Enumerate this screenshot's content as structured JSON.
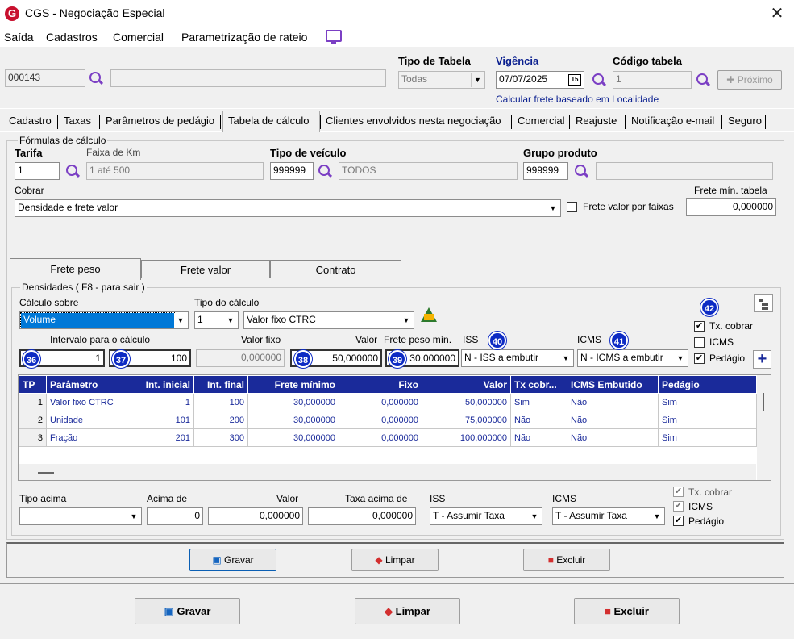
{
  "window": {
    "title": "CGS - Negociação Especial",
    "logo": "G"
  },
  "menu": [
    "Saída",
    "Cadastros",
    "Comercial",
    "Parametrização de rateio"
  ],
  "header": {
    "code": "000143",
    "tipo_tabela_label": "Tipo de Tabela",
    "tipo_tabela_value": "Todas",
    "vigencia_label": "Vigência",
    "vigencia_value": "07/07/2025",
    "calendar_day": "15",
    "codigo_tabela_label": "Código tabela",
    "codigo_tabela_value": "1",
    "proximo_label": "Próximo",
    "calc_link": "Calcular frete baseado em Localidade"
  },
  "tabs": [
    "Cadastro",
    "Taxas",
    "Parâmetros de pedágio",
    "Tabela de cálculo",
    "Clientes envolvidos nesta negociação",
    "Comercial",
    "Reajuste",
    "Notificação e-mail",
    "Seguro"
  ],
  "formulas": {
    "legend": "Fórmulas de cálculo",
    "tarifa_label": "Tarifa",
    "tarifa_value": "1",
    "faixa_label": "Faixa de Km",
    "faixa_value": "1 até 500",
    "tipo_veiculo_label": "Tipo de veículo",
    "tipo_veiculo_code": "999999",
    "tipo_veiculo_desc": "TODOS",
    "grupo_label": "Grupo produto",
    "grupo_code": "999999",
    "grupo_desc": "",
    "cobrar_label": "Cobrar",
    "cobrar_value": "Densidade e frete valor",
    "frete_faixas_label": "Frete valor por faixas",
    "frete_min_label": "Frete mín. tabela",
    "frete_min_value": "0,000000"
  },
  "inner_tabs": [
    "Frete peso",
    "Frete valor",
    "Contrato"
  ],
  "densidades": {
    "legend": "Densidades ( F8 - para sair )",
    "calc_sobre_label": "Cálculo sobre",
    "calc_sobre_value": "Volume",
    "tipo_calc_label": "Tipo do cálculo",
    "tipo_calc_num": "1",
    "tipo_calc_value": "Valor fixo CTRC",
    "intervalo_label": "Intervalo para o cálculo",
    "int_ini": "1",
    "int_fim": "100",
    "valor_fixo_label": "Valor fixo",
    "valor_fixo_value": "0,000000",
    "valor_label": "Valor",
    "valor_value": "50,000000",
    "frete_peso_min_label": "Frete peso mín.",
    "frete_peso_min_value": "30,000000",
    "iss_label": "ISS",
    "iss_value": "N - ISS a embutir",
    "icms_label": "ICMS",
    "icms_value": "N - ICMS a embutir",
    "tx_cobrar_label": "Tx. cobrar",
    "icms_cb_label": "ICMS",
    "pedagio_label": "Pedágio",
    "badges": [
      "36",
      "37",
      "38",
      "39",
      "40",
      "41",
      "42"
    ]
  },
  "grid": {
    "headers": [
      "TP",
      "Parâmetro",
      "Int. inicial",
      "Int. final",
      "Frete mínimo",
      "Fixo",
      "Valor",
      "Tx cobr...",
      "ICMS Embutido",
      "Pedágio"
    ],
    "rows": [
      [
        "1",
        "Valor fixo CTRC",
        "1",
        "100",
        "30,000000",
        "0,000000",
        "50,000000",
        "Sim",
        "Não",
        "Sim"
      ],
      [
        "2",
        "Unidade",
        "101",
        "200",
        "30,000000",
        "0,000000",
        "75,000000",
        "Não",
        "Não",
        "Sim"
      ],
      [
        "3",
        "Fração",
        "201",
        "300",
        "30,000000",
        "0,000000",
        "100,000000",
        "Não",
        "Não",
        "Sim"
      ]
    ]
  },
  "bottom": {
    "tipo_acima_label": "Tipo acima",
    "tipo_acima_value": "",
    "acima_de_label": "Acima de",
    "acima_de_value": "0",
    "valor_label": "Valor",
    "valor_value": "0,000000",
    "taxa_acima_label": "Taxa acima de",
    "taxa_acima_value": "0,000000",
    "iss_label": "ISS",
    "iss_value": "T - Assumir Taxa",
    "icms_label": "ICMS",
    "icms_value": "T - Assumir Taxa",
    "tx_cobrar_label": "Tx. cobrar",
    "icms_cb_label": "ICMS",
    "pedagio_label": "Pedágio"
  },
  "inner_buttons": {
    "gravar": "Gravar",
    "limpar": "Limpar",
    "excluir": "Excluir"
  },
  "main_buttons": {
    "gravar": "Gravar",
    "limpar": "Limpar",
    "excluir": "Excluir"
  },
  "colors": {
    "accent": "#1a2a9a",
    "badge": "#0d2bc4",
    "search": "#7b3fc4",
    "logo": "#c8102e"
  }
}
